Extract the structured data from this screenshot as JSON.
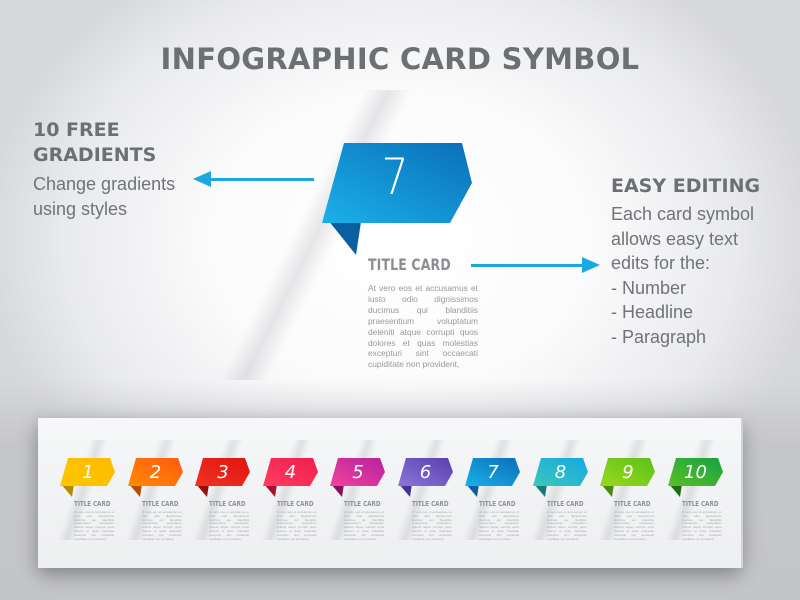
{
  "title": "INFOGRAPHIC CARD SYMBOL",
  "left_feature": {
    "heading_lines": [
      "10 FREE",
      "GRADIENTS"
    ],
    "description_lines": [
      "Change gradients",
      "using styles"
    ],
    "arrow_icon": "arrow-left-icon"
  },
  "right_feature": {
    "heading": "EASY EDITING",
    "description_lines": [
      "Each card symbol",
      "allows easy text",
      "edits for the:",
      "- Number",
      "- Headline",
      "- Paragraph"
    ],
    "arrow_icon": "arrow-right-icon"
  },
  "hero_card": {
    "number": "7",
    "title": "TITLE CARD",
    "paragraph": "At vero eos et accusamus et iusto odio dignissimos ducimus qui blanditiis praesentium voluptatum deleniti atque corrupti quos dolores et quas molestias excepturi sint occaecati cupiditate non provident,",
    "color_light": "#1bb0ea",
    "color_dark": "#0a6fb8",
    "fold_color": "#0b5fa0"
  },
  "accent_color": "#19a8e2",
  "cards": [
    {
      "number": "1",
      "title": "TITLE CARD",
      "light": "#f9c800",
      "dark": "#ffba00",
      "fold": "#b38a00"
    },
    {
      "number": "2",
      "title": "TITLE CARD",
      "light": "#ff8a00",
      "dark": "#ff5a12",
      "fold": "#b44e00"
    },
    {
      "number": "3",
      "title": "TITLE CARD",
      "light": "#ee3324",
      "dark": "#e2140f",
      "fold": "#9c0d0a"
    },
    {
      "number": "4",
      "title": "TITLE CARD",
      "light": "#ff3e63",
      "dark": "#ef1d4b",
      "fold": "#a8102f"
    },
    {
      "number": "5",
      "title": "TITLE CARD",
      "light": "#f0449c",
      "dark": "#b5229e",
      "fold": "#8c0d5c"
    },
    {
      "number": "6",
      "title": "TITLE CARD",
      "light": "#8a76d8",
      "dark": "#5a3fb0",
      "fold": "#46309a"
    },
    {
      "number": "7",
      "title": "TITLE CARD",
      "light": "#1bb0ea",
      "dark": "#0a6fb8",
      "fold": "#0b5fa0"
    },
    {
      "number": "8",
      "title": "TITLE CARD",
      "light": "#3cc8b8",
      "dark": "#15a8e6",
      "fold": "#137d77"
    },
    {
      "number": "9",
      "title": "TITLE CARD",
      "light": "#9ad81c",
      "dark": "#5cc01a",
      "fold": "#4a8a0f"
    },
    {
      "number": "10",
      "title": "TITLE CARD",
      "light": "#5bbf2a",
      "dark": "#16a240",
      "fold": "#1b6e12"
    }
  ],
  "card_paragraph": "At vero eos et accusamus et iusto odio dignissimos ducimus qui blanditiis praesentium voluptatum deleniti atque corrupti quos dolores et quas molestias excepturi sint occaecati cupiditate non provident,"
}
